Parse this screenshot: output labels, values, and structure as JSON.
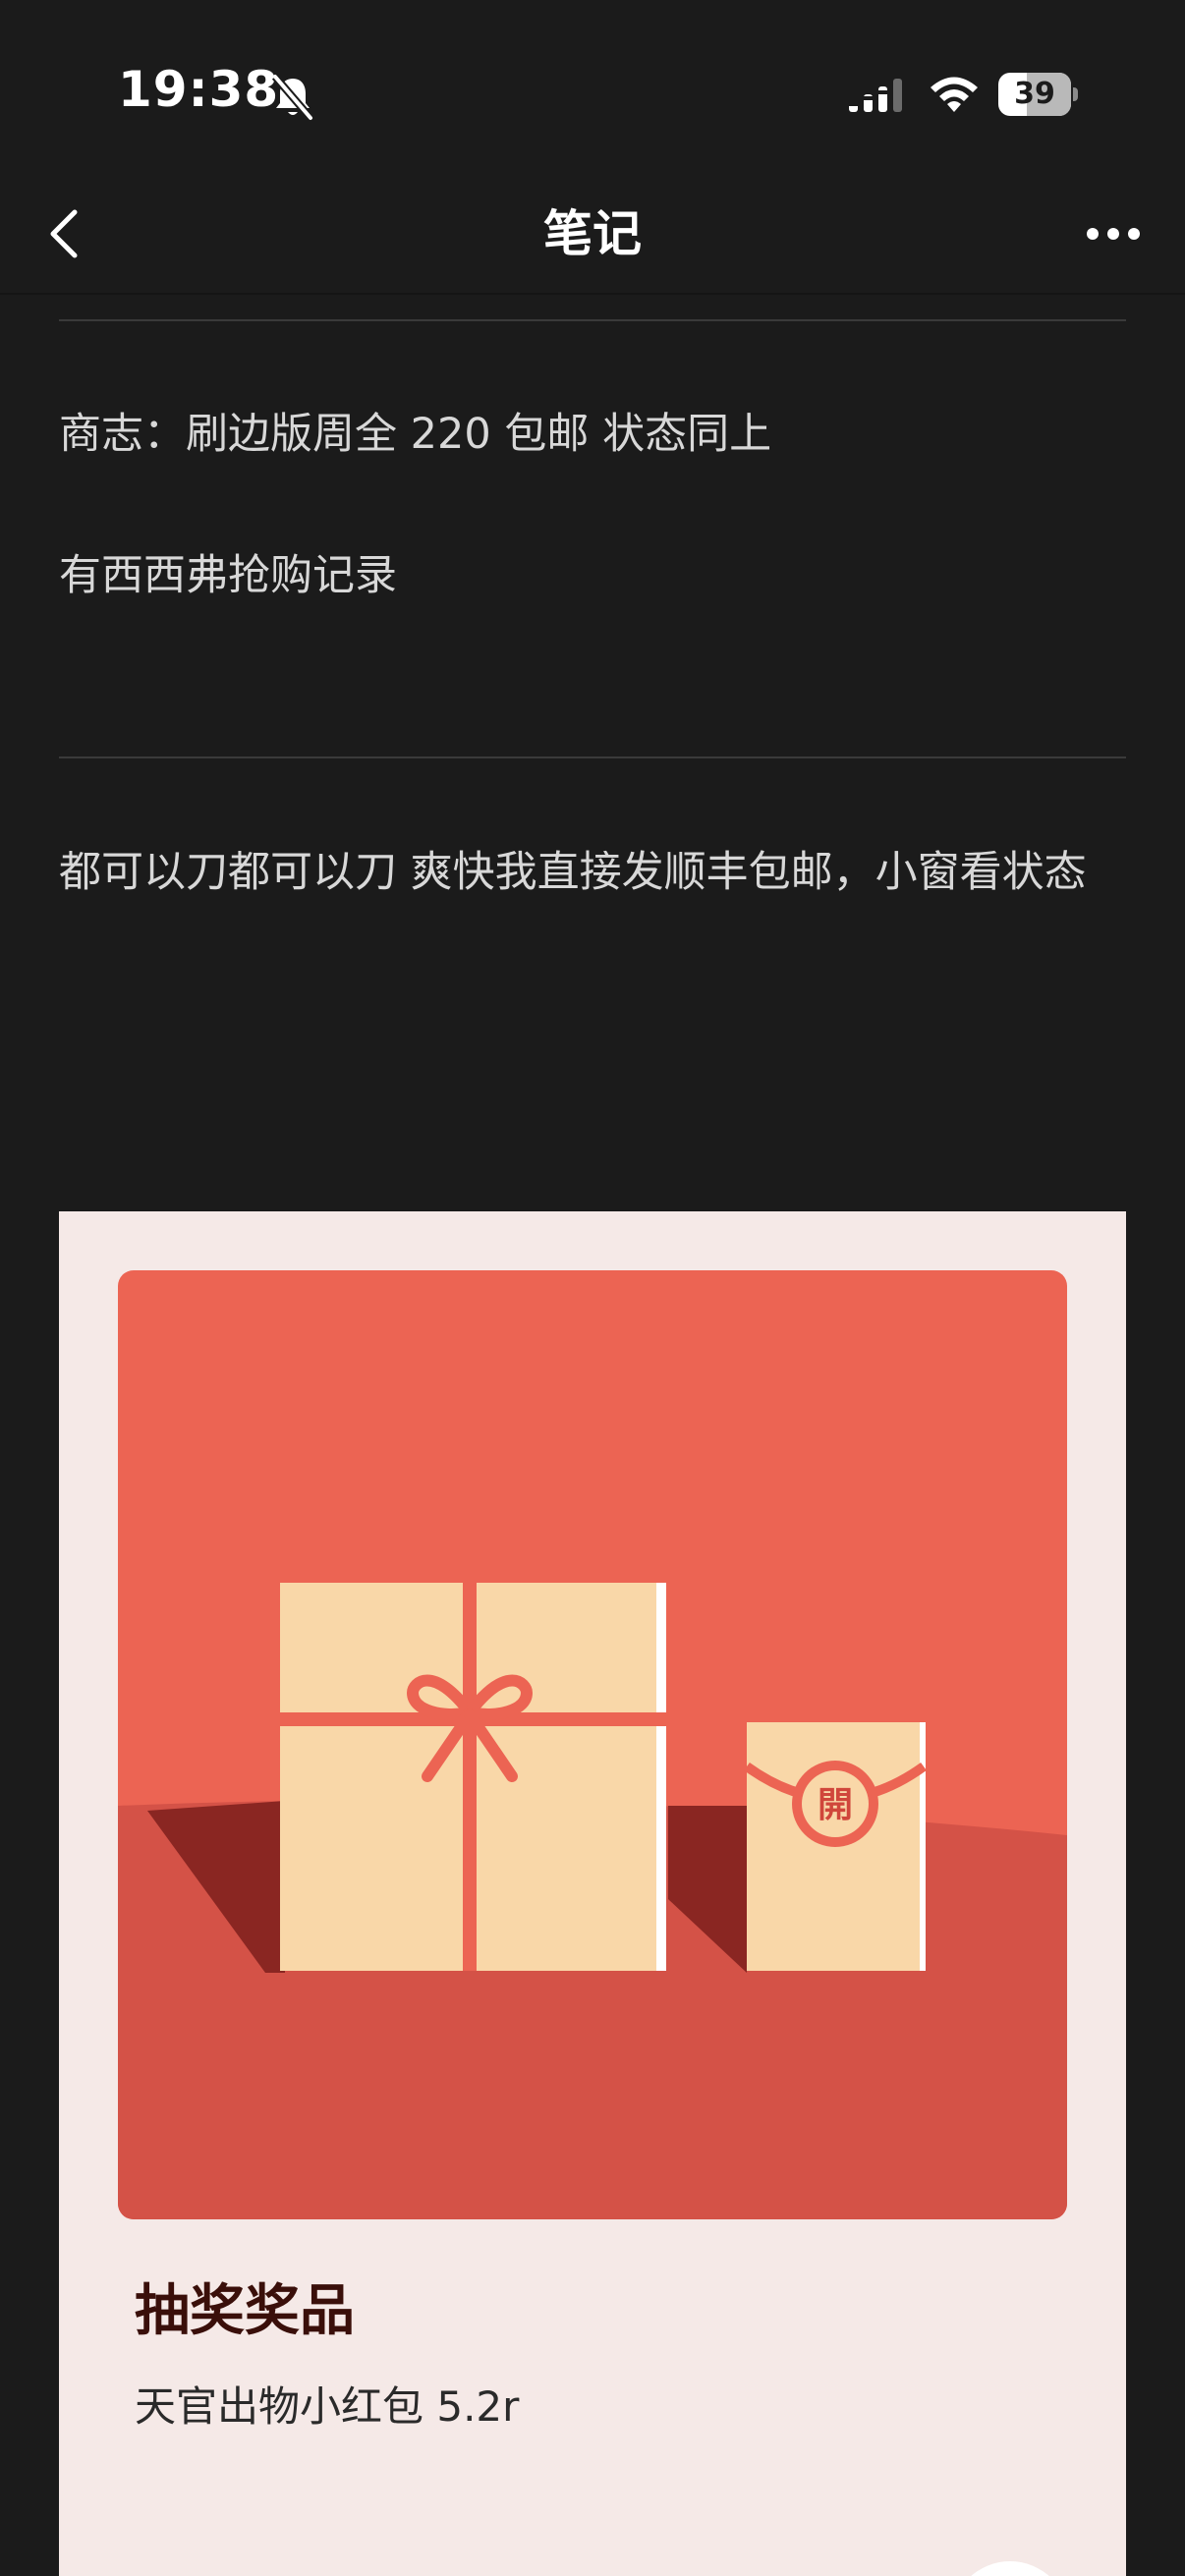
{
  "status_bar": {
    "time": "19:38",
    "battery_text": "39",
    "battery_level": 0.39,
    "icons": [
      "mute-bell-icon",
      "signal-icon",
      "wifi-icon",
      "battery-icon"
    ]
  },
  "nav": {
    "title": "笔记",
    "back_icon": "chevron-left-icon",
    "more_icon": "ellipsis-icon"
  },
  "content": {
    "paragraph_1": "商志：刷边版周全 220 包邮 状态同上",
    "paragraph_2": "有西西弗抢购记录",
    "paragraph_3": "都可以刀都可以刀 爽快我直接发顺丰包邮，小窗看状态"
  },
  "lottery": {
    "title": "抽奖奖品",
    "prize": "天官出物小红包 5.2r",
    "seal_text": "開",
    "colors": {
      "background": "#f5e9e7",
      "sky": "#ec6453",
      "ground": "#d45247",
      "shadow": "#8a2622",
      "box": "#f9d7a8",
      "ribbon": "#ec6453"
    }
  }
}
